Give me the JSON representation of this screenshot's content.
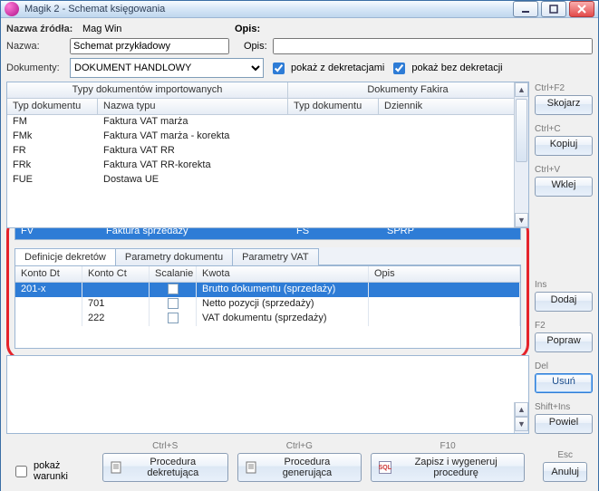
{
  "window": {
    "title": "Magik 2 - Schemat księgowania"
  },
  "header": {
    "source_label": "Nazwa źródła:",
    "source_value": "Mag Win",
    "desc_label": "Opis:",
    "name_label": "Nazwa:",
    "name_value": "Schemat przykładowy",
    "opis_label": "Opis:",
    "opis_value": "",
    "docs_label": "Dokumenty:",
    "docs_value": "DOKUMENT HANDLOWY",
    "chk_with": "pokaż z dekretacjami",
    "chk_without": "pokaż bez dekretacji"
  },
  "top_grid": {
    "section_left": "Typy dokumentów importowanych",
    "section_right": "Dokumenty Fakira",
    "cols": {
      "typ": "Typ dokumentu",
      "nazwa": "Nazwa typu",
      "typ_f": "Typ dokumentu",
      "dziennik": "Dziennik"
    },
    "rows": [
      {
        "typ": "FM",
        "nazwa": "Faktura VAT marża"
      },
      {
        "typ": "FMk",
        "nazwa": "Faktura VAT marża - korekta"
      },
      {
        "typ": "FR",
        "nazwa": "Faktura VAT RR"
      },
      {
        "typ": "FRk",
        "nazwa": "Faktura VAT RR-korekta"
      },
      {
        "typ": "FUE",
        "nazwa": "Dostawa UE"
      }
    ],
    "sel": {
      "typ": "FV",
      "nazwa": "Faktura sprzedaży",
      "typ_f": "FS",
      "dziennik": "SPRP"
    }
  },
  "tabs": {
    "t1": "Definicje dekretów",
    "t2": "Parametry dokumentu",
    "t3": "Parametry VAT"
  },
  "decree": {
    "cols": {
      "dt": "Konto Dt",
      "ct": "Konto Ct",
      "scal": "Scalanie",
      "kwota": "Kwota",
      "opis": "Opis"
    },
    "rows": [
      {
        "dt": "201-x",
        "ct": "",
        "kwota": "Brutto dokumentu (sprzedaży)",
        "opis": ""
      },
      {
        "dt": "",
        "ct": "701",
        "kwota": "Netto pozycji (sprzedaży)",
        "opis": ""
      },
      {
        "dt": "",
        "ct": "222",
        "kwota": "VAT dokumentu (sprzedaży)",
        "opis": ""
      }
    ]
  },
  "sidebtns": {
    "group1": {
      "hint": "Ctrl+F2",
      "label": "Skojarz"
    },
    "group2": {
      "hint": "Ctrl+C",
      "label": "Kopiuj"
    },
    "group3": {
      "hint": "Ctrl+V",
      "label": "Wklej"
    },
    "group4": {
      "hint": "Ins",
      "label": "Dodaj"
    },
    "group5": {
      "hint": "F2",
      "label": "Popraw"
    },
    "group6": {
      "hint": "Del",
      "label": "Usuń"
    },
    "group7": {
      "hint": "Shift+Ins",
      "label": "Powiel"
    }
  },
  "bottom": {
    "chk_warunki": "pokaż warunki",
    "btn1": {
      "hint": "Ctrl+S",
      "label": "Procedura dekretująca"
    },
    "btn2": {
      "hint": "Ctrl+G",
      "label": "Procedura generująca"
    },
    "btn3": {
      "hint": "F10",
      "label": "Zapisz i wygeneruj procedurę"
    },
    "btn4": {
      "hint": "Esc",
      "label": "Anuluj"
    }
  }
}
